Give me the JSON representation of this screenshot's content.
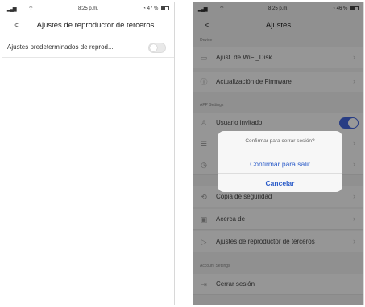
{
  "left_screen": {
    "status": {
      "time": "8:25 p.m.",
      "battery": "47 %"
    },
    "nav": {
      "back": "<",
      "title": "Ajustes de reproductor de terceros"
    },
    "setting": {
      "label": "Ajustes predeterminados de reprod...",
      "enabled": false
    }
  },
  "right_screen": {
    "status": {
      "time": "8:25 p.m.",
      "battery": "46 %"
    },
    "nav": {
      "back": "<",
      "title": "Ajustes"
    },
    "sections": {
      "device": "Device",
      "app": "APP Settings",
      "account": "Account Settings"
    },
    "items": [
      {
        "label": "Ajust. de WiFi_Disk",
        "icon": "disk-icon"
      },
      {
        "label": "Actualización de Firmware",
        "icon": "info-icon"
      },
      {
        "label": "Usuario invitado",
        "icon": "user-icon",
        "toggle": true
      },
      {
        "label": "",
        "icon": "list-icon"
      },
      {
        "label": "",
        "icon": "clock-icon"
      },
      {
        "label": "Copia de seguridad",
        "icon": "backup-icon"
      },
      {
        "label": "Acerca de",
        "icon": "about-icon"
      },
      {
        "label": "Ajustes de reproductor de terceros",
        "icon": "player-icon"
      },
      {
        "label": "Cerrar sesión",
        "icon": "logout-icon"
      }
    ],
    "dialog": {
      "message": "Confirmar para cerrar sesión?",
      "confirm": "Confirmar para salir",
      "cancel": "Cancelar"
    },
    "colors": {
      "accent": "#2b5cc9",
      "toggle_on": "#4466dd"
    }
  }
}
